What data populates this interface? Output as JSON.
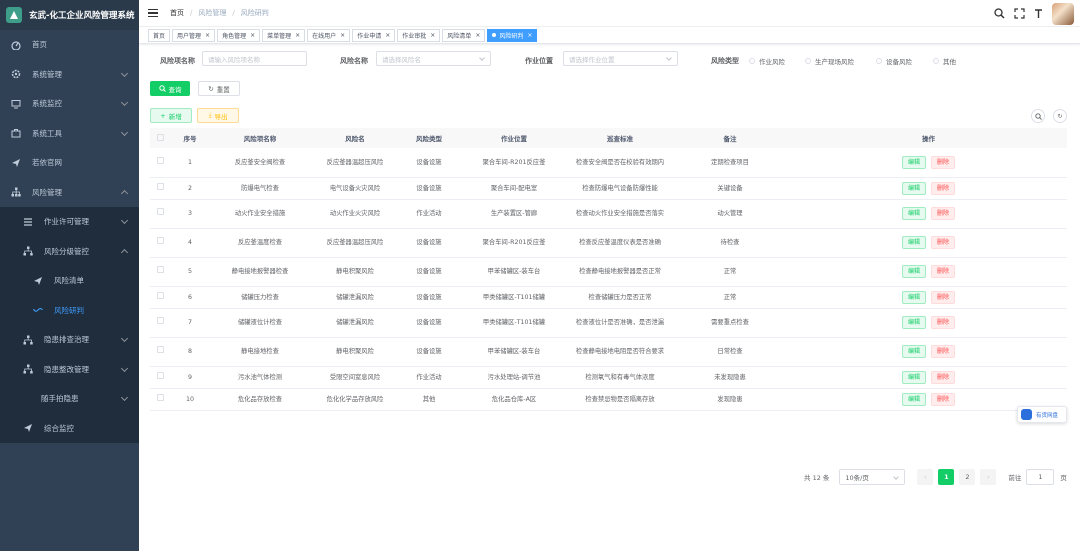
{
  "app": {
    "title": "玄武-化工企业风险管理系统"
  },
  "sidebar": {
    "items": [
      {
        "label": "首页",
        "icon": "dashboard-icon"
      },
      {
        "label": "系统管理",
        "icon": "gear-icon"
      },
      {
        "label": "系统监控",
        "icon": "monitor-icon"
      },
      {
        "label": "系统工具",
        "icon": "toolbox-icon"
      },
      {
        "label": "若依官网",
        "icon": "paper-plane-icon"
      },
      {
        "label": "风险管理",
        "icon": "tree-icon"
      },
      {
        "label": "作业许可管理",
        "icon": "list-icon"
      },
      {
        "label": "风险分级管控",
        "icon": "tree-icon"
      },
      {
        "label": "风险清单",
        "icon": "paper-plane-icon"
      },
      {
        "label": "风险研判",
        "icon": "wave-icon"
      },
      {
        "label": "隐患排查治理",
        "icon": "tree-icon"
      },
      {
        "label": "隐患整改管理",
        "icon": "tree-icon"
      },
      {
        "label": "随手拍隐患",
        "icon": ""
      },
      {
        "label": "综合监控",
        "icon": "paper-plane-icon"
      }
    ]
  },
  "breadcrumb": [
    "首页",
    "风险管理",
    "风险研判"
  ],
  "tabs": [
    {
      "label": "首页",
      "closable": false
    },
    {
      "label": "用户管理",
      "closable": true
    },
    {
      "label": "角色管理",
      "closable": true
    },
    {
      "label": "菜单管理",
      "closable": true
    },
    {
      "label": "在线用户",
      "closable": true
    },
    {
      "label": "作业申请",
      "closable": true
    },
    {
      "label": "作业审批",
      "closable": true
    },
    {
      "label": "风险清单",
      "closable": true
    },
    {
      "label": "风险研判",
      "closable": true,
      "active": true
    }
  ],
  "search": {
    "item_name_label": "风险项名称",
    "item_name_placeholder": "请输入风险项名称",
    "risk_name_label": "风险名称",
    "risk_name_placeholder": "请选择风险名",
    "location_label": "作业位置",
    "location_placeholder": "请选择作业位置",
    "type_label": "风险类型",
    "type_options": [
      "作业风险",
      "生产现场风险",
      "设备风险",
      "其他"
    ],
    "query_label": "查询",
    "reset_label": "重置"
  },
  "toolbar": {
    "add_label": "新增",
    "export_label": "导出"
  },
  "table": {
    "headers": [
      "序号",
      "风险项名称",
      "风险名",
      "风险类型",
      "作业位置",
      "巡查标准",
      "备注",
      "操作"
    ],
    "edit_label": "编辑",
    "delete_label": "删除",
    "rows": [
      [
        "1",
        "反应釜安全阀检查",
        "反应釜器温超压风险",
        "设备设施",
        "聚合车间-R201反应釜",
        "检查安全阀是否在校验有效期内",
        "定期检查项目"
      ],
      [
        "2",
        "防爆电气检查",
        "电气设备火灾风险",
        "设备设施",
        "聚合车间-配电室",
        "检查防爆电气设备防爆性能",
        "关键设备"
      ],
      [
        "3",
        "动火作业安全措施",
        "动火作业火灾风险",
        "作业活动",
        "生产装置区-管廊",
        "检查动火作业安全措施是否落实",
        "动火管理"
      ],
      [
        "4",
        "反应釜温度检查",
        "反应釜器温超压风险",
        "设备设施",
        "聚合车间-R201反应釜",
        "检查反应釜温度仪表是否准确",
        "待检查"
      ],
      [
        "5",
        "静电接地报警器检查",
        "静电积聚风险",
        "设备设施",
        "甲苯储罐区-装车台",
        "检查静电接地报警器是否正常",
        "正常"
      ],
      [
        "6",
        "储罐压力检查",
        "储罐泄漏风险",
        "设备设施",
        "甲类储罐区-T101储罐",
        "检查储罐压力是否正常",
        "正常"
      ],
      [
        "7",
        "储罐液位计检查",
        "储罐泄漏风险",
        "设备设施",
        "甲类储罐区-T101储罐",
        "检查液位计是否准确，是否泄漏",
        "需要重点检查"
      ],
      [
        "8",
        "静电接地检查",
        "静电积聚风险",
        "设备设施",
        "甲苯储罐区-装车台",
        "检查静电接地电阻是否符合要求",
        "日常检查"
      ],
      [
        "9",
        "污水池气体检测",
        "受限空间窒息风险",
        "作业活动",
        "污水处理站-调节池",
        "检测氧气和有毒气体浓度",
        "未发现隐患"
      ],
      [
        "10",
        "危化品存放检查",
        "危化化学品存放风险",
        "其他",
        "危化品仓库-A区",
        "检查禁忌物是否隔离存放",
        "发现隐患"
      ]
    ]
  },
  "pagination": {
    "total": "共 12 条",
    "size": "10条/页",
    "pages": [
      "1",
      "2"
    ],
    "goto_label": "前往",
    "goto_value": "1",
    "page_unit": "页"
  },
  "floating": {
    "label": "有货网盘"
  },
  "colors": {
    "sidebar": "#304156",
    "active": "#409eff",
    "primary": "#13ce66",
    "danger": "#ff4949"
  }
}
